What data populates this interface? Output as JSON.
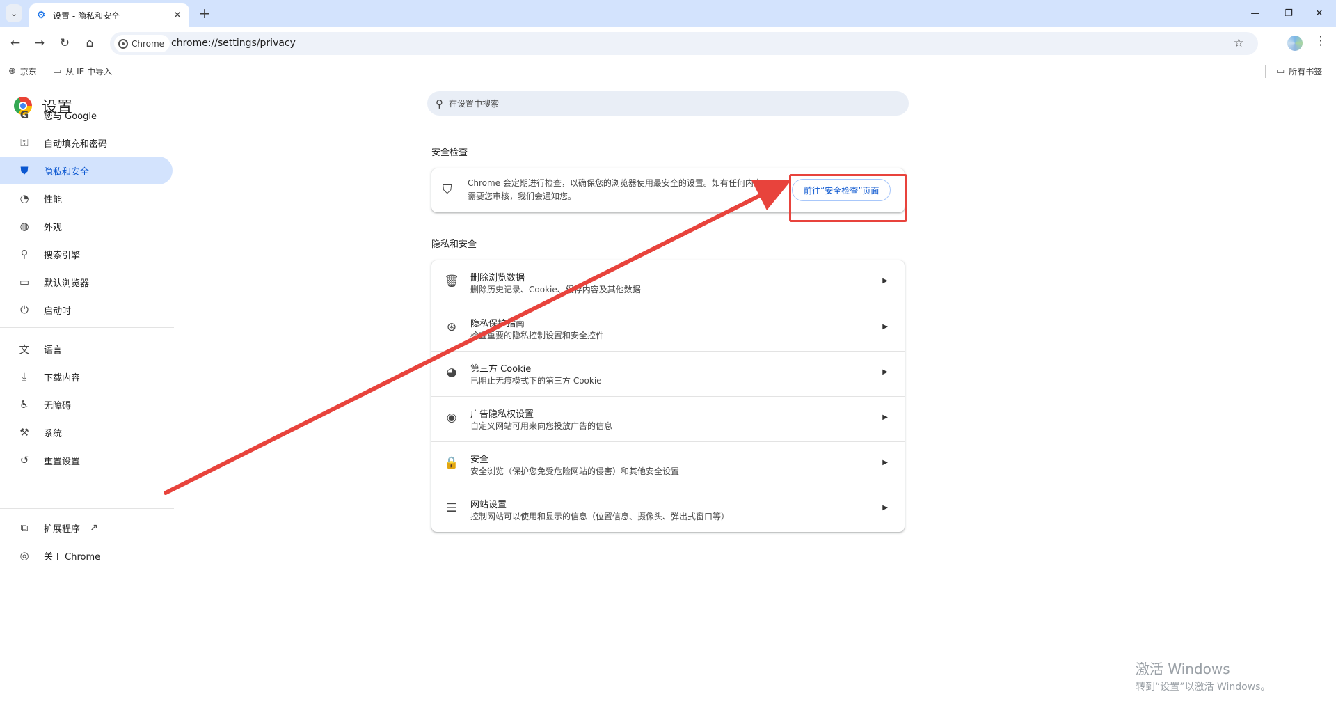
{
  "browser": {
    "tab_title": "设置 - 隐私和安全",
    "new_tab": "+",
    "chip_label": "Chrome",
    "url": "chrome://settings/privacy",
    "bookmarks": [
      {
        "label": "京东",
        "icon": "globe-icon"
      },
      {
        "label": "从 IE 中导入",
        "icon": "folder-icon"
      }
    ],
    "all_bookmarks": "所有书签"
  },
  "sidebar": {
    "title": "设置",
    "items": [
      {
        "label": "您与 Google",
        "icon": "google-icon"
      },
      {
        "label": "自动填充和密码",
        "icon": "key-icon"
      },
      {
        "label": "隐私和安全",
        "icon": "shield-icon",
        "active": true
      },
      {
        "label": "性能",
        "icon": "speedometer-icon"
      },
      {
        "label": "外观",
        "icon": "palette-icon"
      },
      {
        "label": "搜索引擎",
        "icon": "search-icon"
      },
      {
        "label": "默认浏览器",
        "icon": "browser-icon"
      },
      {
        "label": "启动时",
        "icon": "power-icon"
      },
      {
        "label": "语言",
        "icon": "translate-icon"
      },
      {
        "label": "下载内容",
        "icon": "download-icon"
      },
      {
        "label": "无障碍",
        "icon": "accessibility-icon"
      },
      {
        "label": "系统",
        "icon": "wrench-icon"
      },
      {
        "label": "重置设置",
        "icon": "reset-icon"
      },
      {
        "label": "扩展程序",
        "icon": "puzzle-icon"
      },
      {
        "label": "关于 Chrome",
        "icon": "chrome-icon"
      }
    ]
  },
  "search": {
    "placeholder": "在设置中搜索"
  },
  "safety_check": {
    "heading": "安全检查",
    "description": "Chrome 会定期进行检查，以确保您的浏览器使用最安全的设置。如有任何内容需要您审核，我们会通知您。",
    "button": "前往“安全检查”页面"
  },
  "privacy": {
    "heading": "隐私和安全",
    "rows": [
      {
        "title": "删除浏览数据",
        "subtitle": "删除历史记录、Cookie、缓存内容及其他数据",
        "icon": "trash-icon"
      },
      {
        "title": "隐私保护指南",
        "subtitle": "检查重要的隐私控制设置和安全控件",
        "icon": "compass-icon"
      },
      {
        "title": "第三方 Cookie",
        "subtitle": "已阻止无痕模式下的第三方 Cookie",
        "icon": "cookie-icon"
      },
      {
        "title": "广告隐私权设置",
        "subtitle": "自定义网站可用来向您投放广告的信息",
        "icon": "ad-privacy-icon"
      },
      {
        "title": "安全",
        "subtitle": "安全浏览（保护您免受危险网站的侵害）和其他安全设置",
        "icon": "lock-icon"
      },
      {
        "title": "网站设置",
        "subtitle": "控制网站可以使用和显示的信息（位置信息、摄像头、弹出式窗口等）",
        "icon": "sliders-icon"
      }
    ]
  },
  "annotation": {
    "color": "#e8433c"
  },
  "watermark": {
    "line1": "激活 Windows",
    "line2": "转到“设置”以激活 Windows。"
  }
}
